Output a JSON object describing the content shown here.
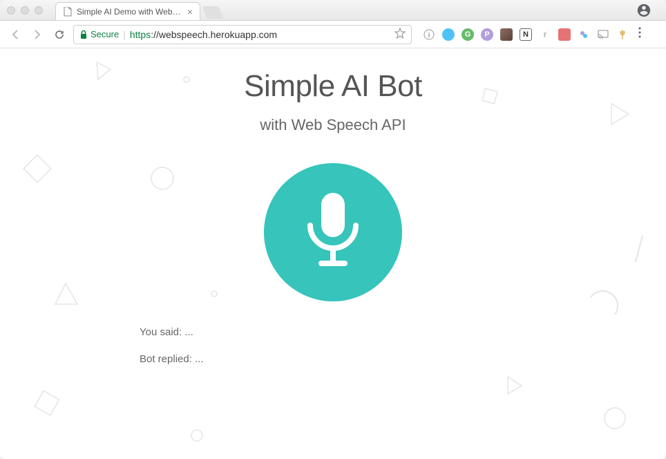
{
  "browser": {
    "tab_title": "Simple AI Demo with Web Spe...",
    "secure_label": "Secure",
    "url_protocol": "https",
    "url_domain": "://webspeech.herokuapp.com"
  },
  "page": {
    "title": "Simple AI Bot",
    "subtitle": "with Web Speech API",
    "you_said_label": "You said: ",
    "you_said_value": "...",
    "bot_replied_label": "Bot replied: ",
    "bot_replied_value": "...",
    "mic_color": "#36c4bb"
  }
}
